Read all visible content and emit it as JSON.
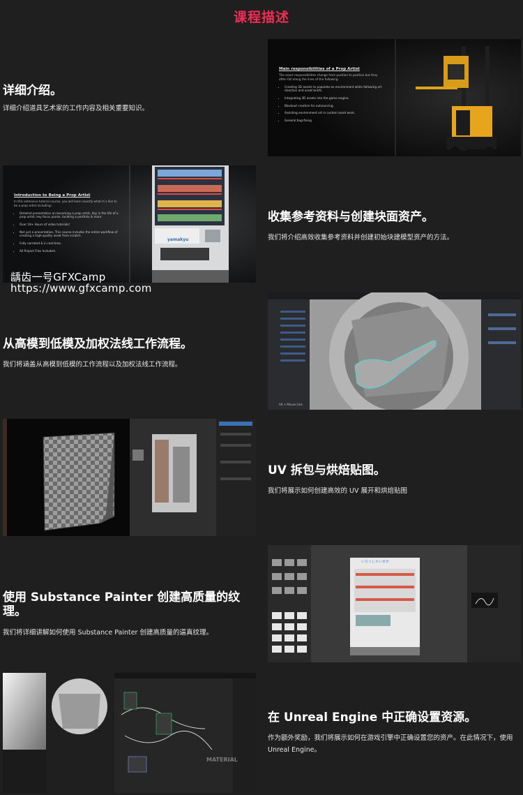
{
  "page": {
    "title": "课程描述"
  },
  "watermark": {
    "line1": "龋齿一号GFXCamp",
    "line2": "https://www.gfxcamp.com"
  },
  "sections": [
    {
      "title": "详细介绍。",
      "desc": "详细介绍道具艺术家的工作内容及相关重要知识。"
    },
    {
      "title": "收集参考资料与创建块面资产。",
      "desc": "我们将介绍高效收集参考资料并创建初始块建模型资产的方法。"
    },
    {
      "title": "从高模到低模及加权法线工作流程。",
      "desc": "我们将涵盖从高模到低模的工作流程以及加权法线工作流程。"
    },
    {
      "title": "UV 拆包与烘焙贴图。",
      "desc": "我们将展示如何创建高效的 UV 展开和烘焙贴图"
    },
    {
      "title": "使用 Substance Painter 创建高质量的纹理。",
      "desc": "我们将详细讲解如何使用 Substance Painter 创建高质量的逼真纹理。"
    },
    {
      "title": "在 Unreal Engine 中正确设置资源。",
      "desc": "作为额外奖励，我们将展示如何在游戏引擎中正确设置您的资产。在此情况下，使用 Unreal Engine。"
    }
  ],
  "slide1": {
    "title": "Main responsibilities of a Prop Artist",
    "intro": "The exact responsibilities change from position to position but they often fall along the lines of the following:",
    "bullets": [
      "Creating 3D assets to populate an environment while following art direction and asset briefs.",
      "Integrating 3D assets into the game engine.",
      "Blockout creation for outsourcing.",
      "Assisting environment art in custom asset work.",
      "General bug-fixing"
    ]
  },
  "slide2": {
    "title": "Introduction to Being a Prop Artist",
    "intro": "In this extensive tutorial course, you will learn exactly what it is like to be a prop artist including:",
    "bullets": [
      "Detailed presentation on becoming a prop artist, day in the life of a prop artist, key focus points, building a portfolio & more.",
      "Over 18+ Hours of video tutorials!",
      "Not just a presentation, This course includes the entire workflow of creating a high-quality asset from scratch.",
      "Fully narrated & in real-time.",
      "All Project Files Included."
    ],
    "machine_label": "yamakyu"
  },
  "img3": {
    "caption": "Alt + Mouse Line"
  },
  "img5": {
    "machine_label": "いらっしゃいませ"
  },
  "img6": {
    "overlay": "MATERIAL"
  },
  "colors": {
    "accent": "#ef2d54",
    "background": "#1f1f20"
  }
}
